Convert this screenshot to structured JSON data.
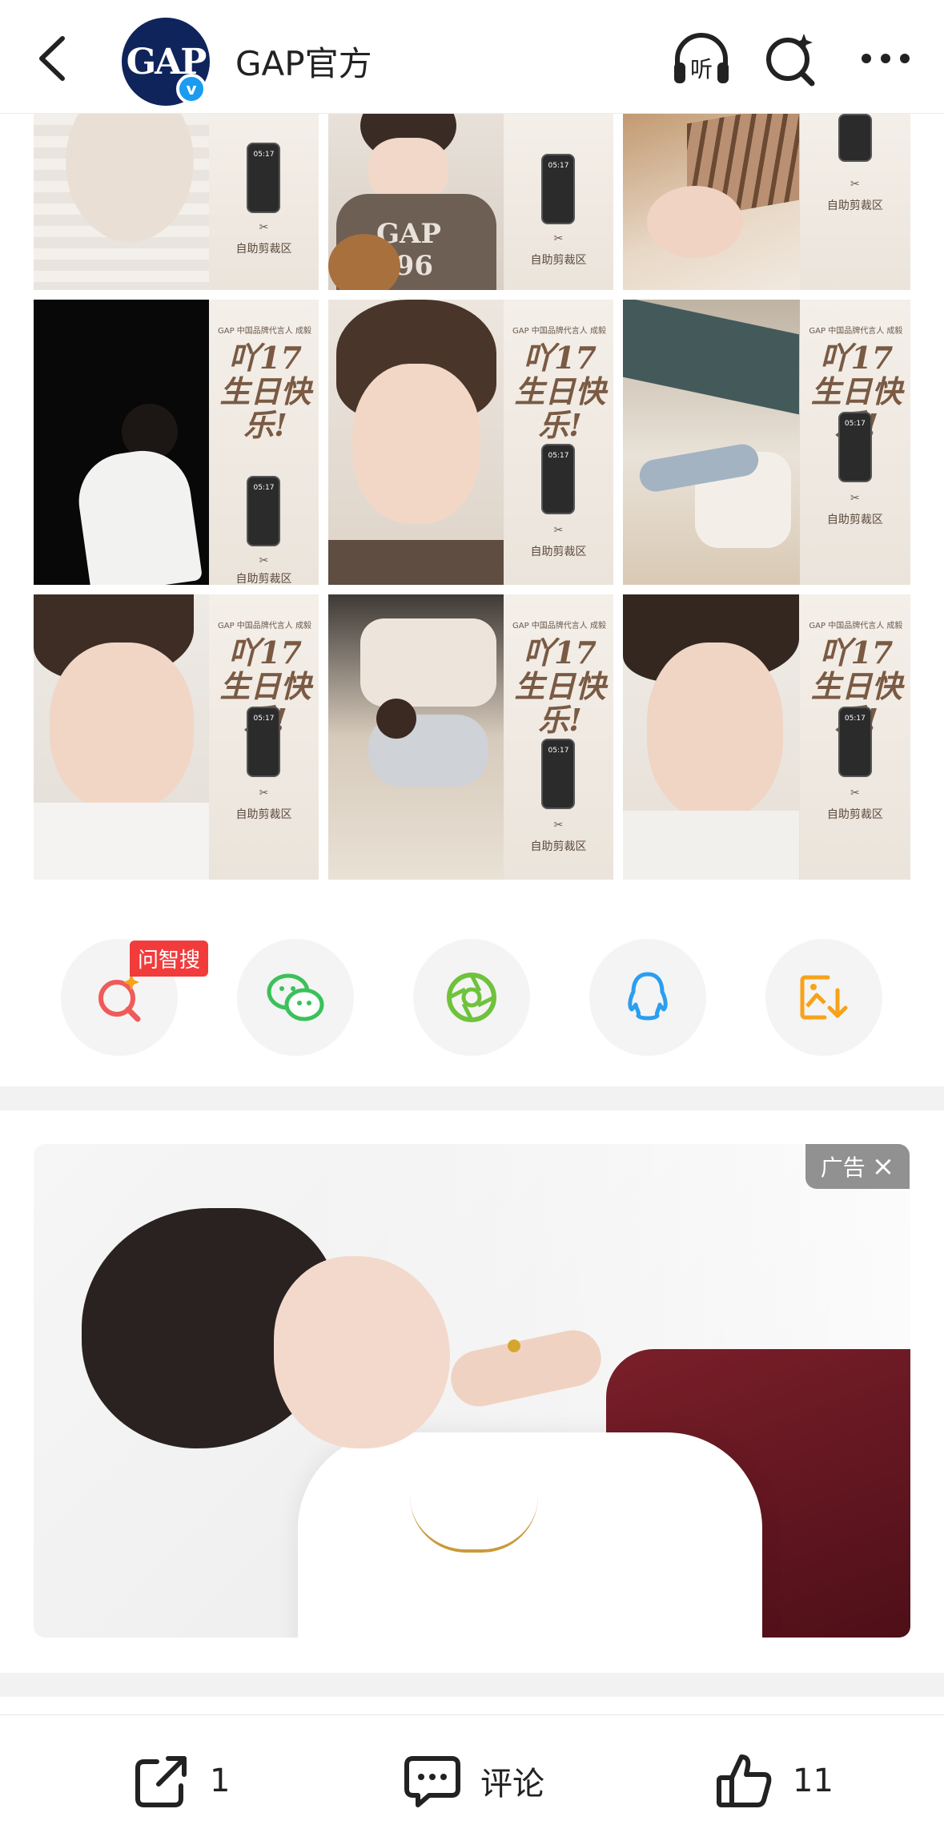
{
  "header": {
    "avatar_text": "GAP",
    "verified_mark": "v",
    "account_name": "GAP官方",
    "icons": [
      "back-arrow-icon",
      "listen-icon",
      "ai-search-icon",
      "more-icon"
    ],
    "listen_glyph": "听"
  },
  "grid": {
    "brand_line": "GAP 中国品牌代言人 成毅",
    "script_text": "吖17 生日快乐!",
    "phone_time": "05:17",
    "scissors": "✂",
    "crop_label": "自助剪裁区"
  },
  "share": {
    "ask_badge": "问智搜",
    "buttons": [
      "ai-search-share",
      "wechat",
      "moments",
      "qq",
      "save-image"
    ],
    "accent_colors": {
      "ai": "#f05a5a",
      "wechat": "#3bc15a",
      "moments": "#6fc23c",
      "qq": "#2a9ef0",
      "save": "#f7a21b"
    }
  },
  "ad": {
    "badge_label": "广告",
    "close_glyph": "×"
  },
  "bottom_bar": {
    "share_count": "1",
    "comment_label": "评论",
    "like_count": "11"
  }
}
